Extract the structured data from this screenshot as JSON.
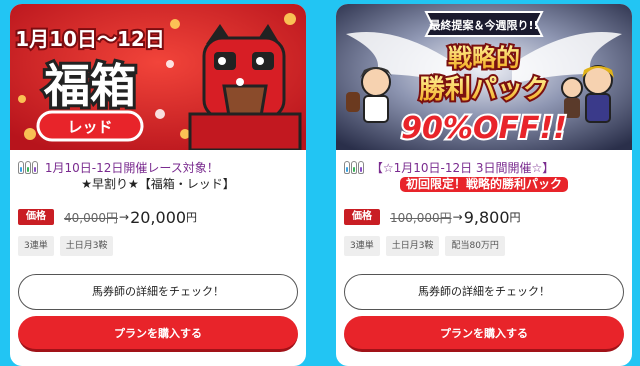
{
  "colors": {
    "background": "#22c5f3",
    "accent_red": "#e8242a",
    "price_label": "#c91e24",
    "title_purple": "#7a2b8f"
  },
  "cards": [
    {
      "banner": {
        "date_text": "1月10日〜12日",
        "main_text": "福箱",
        "sub_text": "レッド"
      },
      "title_line1": "1月10日-12日開催レース対象！",
      "title_line2": "★早割り★【福箱・レッド】",
      "price_label": "価格",
      "old_price": "40,000円",
      "arrow": "→",
      "new_price": "20,000",
      "yen": "円",
      "tags": [
        "3連単",
        "土日月3鞍"
      ],
      "detail_button": "馬券師の詳細をチェック！",
      "buy_button": "プランを購入する"
    },
    {
      "banner": {
        "ribbon_text": "最終提案＆今週限り!!",
        "main_line1": "戦略的",
        "main_line2": "勝利パック",
        "discount_text": "90%OFF!!"
      },
      "title_line1": "【☆1月10日-12日 3日間開催☆】",
      "title_badge": "初回限定！戦略的勝利パック",
      "price_label": "価格",
      "old_price": "100,000円",
      "arrow": "→",
      "new_price": "9,800",
      "yen": "円",
      "tags": [
        "3連単",
        "土日月3鞍",
        "配当80万円"
      ],
      "detail_button": "馬券師の詳細をチェック！",
      "buy_button": "プランを購入する"
    }
  ]
}
